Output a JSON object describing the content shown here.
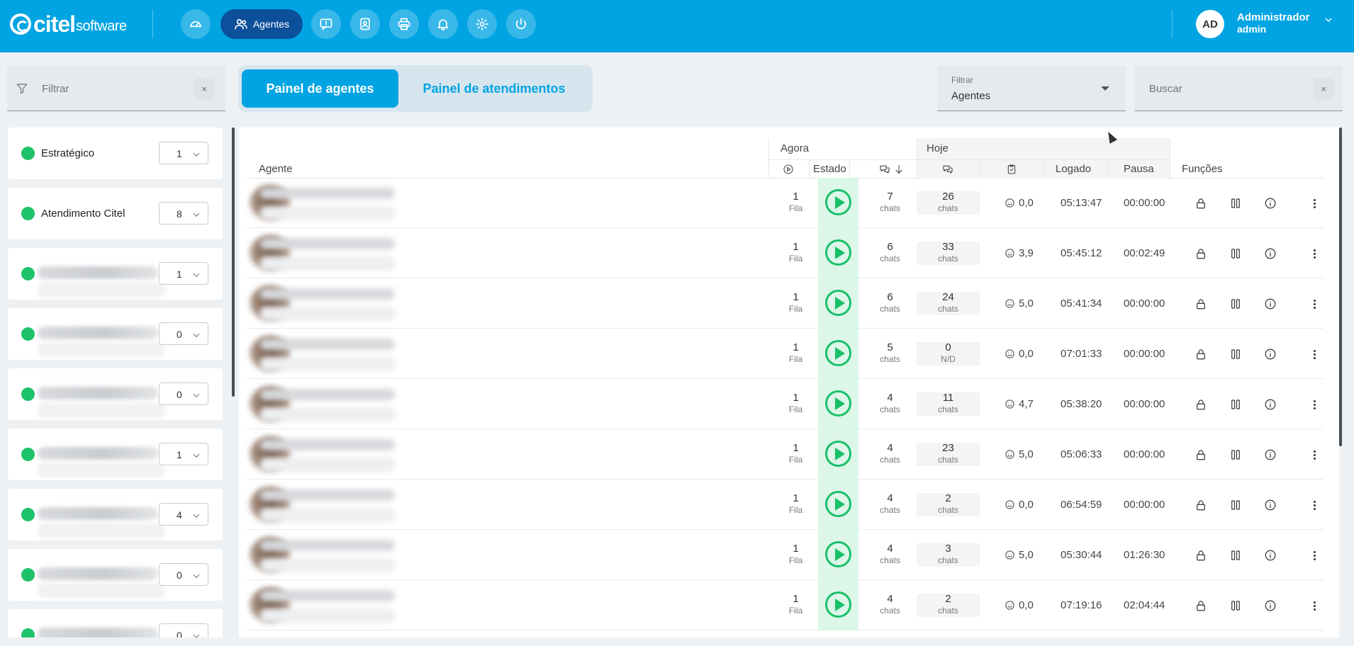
{
  "header": {
    "logo_brand": "citel",
    "logo_suffix": "software",
    "nav": [
      {
        "icon": "dashboard-icon"
      },
      {
        "icon": "users-icon",
        "label": "Agentes",
        "active": true
      },
      {
        "icon": "chat-alert-icon"
      },
      {
        "icon": "contacts-icon"
      },
      {
        "icon": "printer-icon"
      },
      {
        "icon": "bell-icon"
      },
      {
        "icon": "gear-icon"
      },
      {
        "icon": "power-icon"
      }
    ],
    "user": {
      "initials": "AD",
      "name": "Administrador",
      "role": "admin"
    }
  },
  "left_filter": {
    "placeholder": "Filtrar",
    "clear": "×"
  },
  "tabs": [
    {
      "label": "Painel de agentes",
      "active": true
    },
    {
      "label": "Painel de atendimentos",
      "active": false
    }
  ],
  "right_filter": {
    "label": "Filtrar",
    "value": "Agentes"
  },
  "search": {
    "placeholder": "Buscar",
    "clear": "×"
  },
  "groups": [
    {
      "name": "Estratégico",
      "count": "1",
      "status_color": "#1ec26b"
    },
    {
      "name": "Atendimento Citel",
      "count": "8",
      "status_color": "#1ec26b"
    },
    {
      "name": "",
      "count": "1",
      "status_color": "#1ec26b"
    },
    {
      "name": "",
      "count": "0",
      "status_color": "#1ec26b"
    },
    {
      "name": "",
      "count": "0",
      "status_color": "#1ec26b"
    },
    {
      "name": "",
      "count": "1",
      "status_color": "#1ec26b"
    },
    {
      "name": "",
      "count": "4",
      "status_color": "#1ec26b"
    },
    {
      "name": "",
      "count": "0",
      "status_color": "#1ec26b"
    },
    {
      "name": "",
      "count": "0",
      "status_color": "#1ec26b"
    }
  ],
  "table": {
    "headers": {
      "agente": "Agente",
      "agora": "Agora",
      "hoje": "Hoje",
      "estado": "Estado",
      "logado": "Logado",
      "pausa": "Pausa",
      "funcoes": "Funções"
    },
    "rows": [
      {
        "fila": "1",
        "fila_label": "Fila",
        "chats_now": "7",
        "chats_label": "chats",
        "chats_today": "26",
        "chats_today_label": "chats",
        "satisfaction": "0,0",
        "logado": "05:13:47",
        "pausa": "00:00:00"
      },
      {
        "fila": "1",
        "fila_label": "Fila",
        "chats_now": "6",
        "chats_label": "chats",
        "chats_today": "33",
        "chats_today_label": "chats",
        "satisfaction": "3,9",
        "logado": "05:45:12",
        "pausa": "00:02:49"
      },
      {
        "fila": "1",
        "fila_label": "Fila",
        "chats_now": "6",
        "chats_label": "chats",
        "chats_today": "24",
        "chats_today_label": "chats",
        "satisfaction": "5,0",
        "logado": "05:41:34",
        "pausa": "00:00:00"
      },
      {
        "fila": "1",
        "fila_label": "Fila",
        "chats_now": "5",
        "chats_label": "chats",
        "chats_today": "0",
        "chats_today_label": "N/D",
        "satisfaction": "0,0",
        "logado": "07:01:33",
        "pausa": "00:00:00"
      },
      {
        "fila": "1",
        "fila_label": "Fila",
        "chats_now": "4",
        "chats_label": "chats",
        "chats_today": "11",
        "chats_today_label": "chats",
        "satisfaction": "4,7",
        "logado": "05:38:20",
        "pausa": "00:00:00"
      },
      {
        "fila": "1",
        "fila_label": "Fila",
        "chats_now": "4",
        "chats_label": "chats",
        "chats_today": "23",
        "chats_today_label": "chats",
        "satisfaction": "5,0",
        "logado": "05:06:33",
        "pausa": "00:00:00"
      },
      {
        "fila": "1",
        "fila_label": "Fila",
        "chats_now": "4",
        "chats_label": "chats",
        "chats_today": "2",
        "chats_today_label": "chats",
        "satisfaction": "0,0",
        "logado": "06:54:59",
        "pausa": "00:00:00"
      },
      {
        "fila": "1",
        "fila_label": "Fila",
        "chats_now": "4",
        "chats_label": "chats",
        "chats_today": "3",
        "chats_today_label": "chats",
        "satisfaction": "5,0",
        "logado": "05:30:44",
        "pausa": "01:26:30"
      },
      {
        "fila": "1",
        "fila_label": "Fila",
        "chats_now": "4",
        "chats_label": "chats",
        "chats_today": "2",
        "chats_today_label": "chats",
        "satisfaction": "0,0",
        "logado": "07:19:16",
        "pausa": "02:04:44"
      }
    ]
  },
  "colors": {
    "primary": "#00a4e3",
    "active_nav": "#0c4f9a",
    "online": "#1ec26b",
    "estado_bg": "#dcf6e7"
  }
}
